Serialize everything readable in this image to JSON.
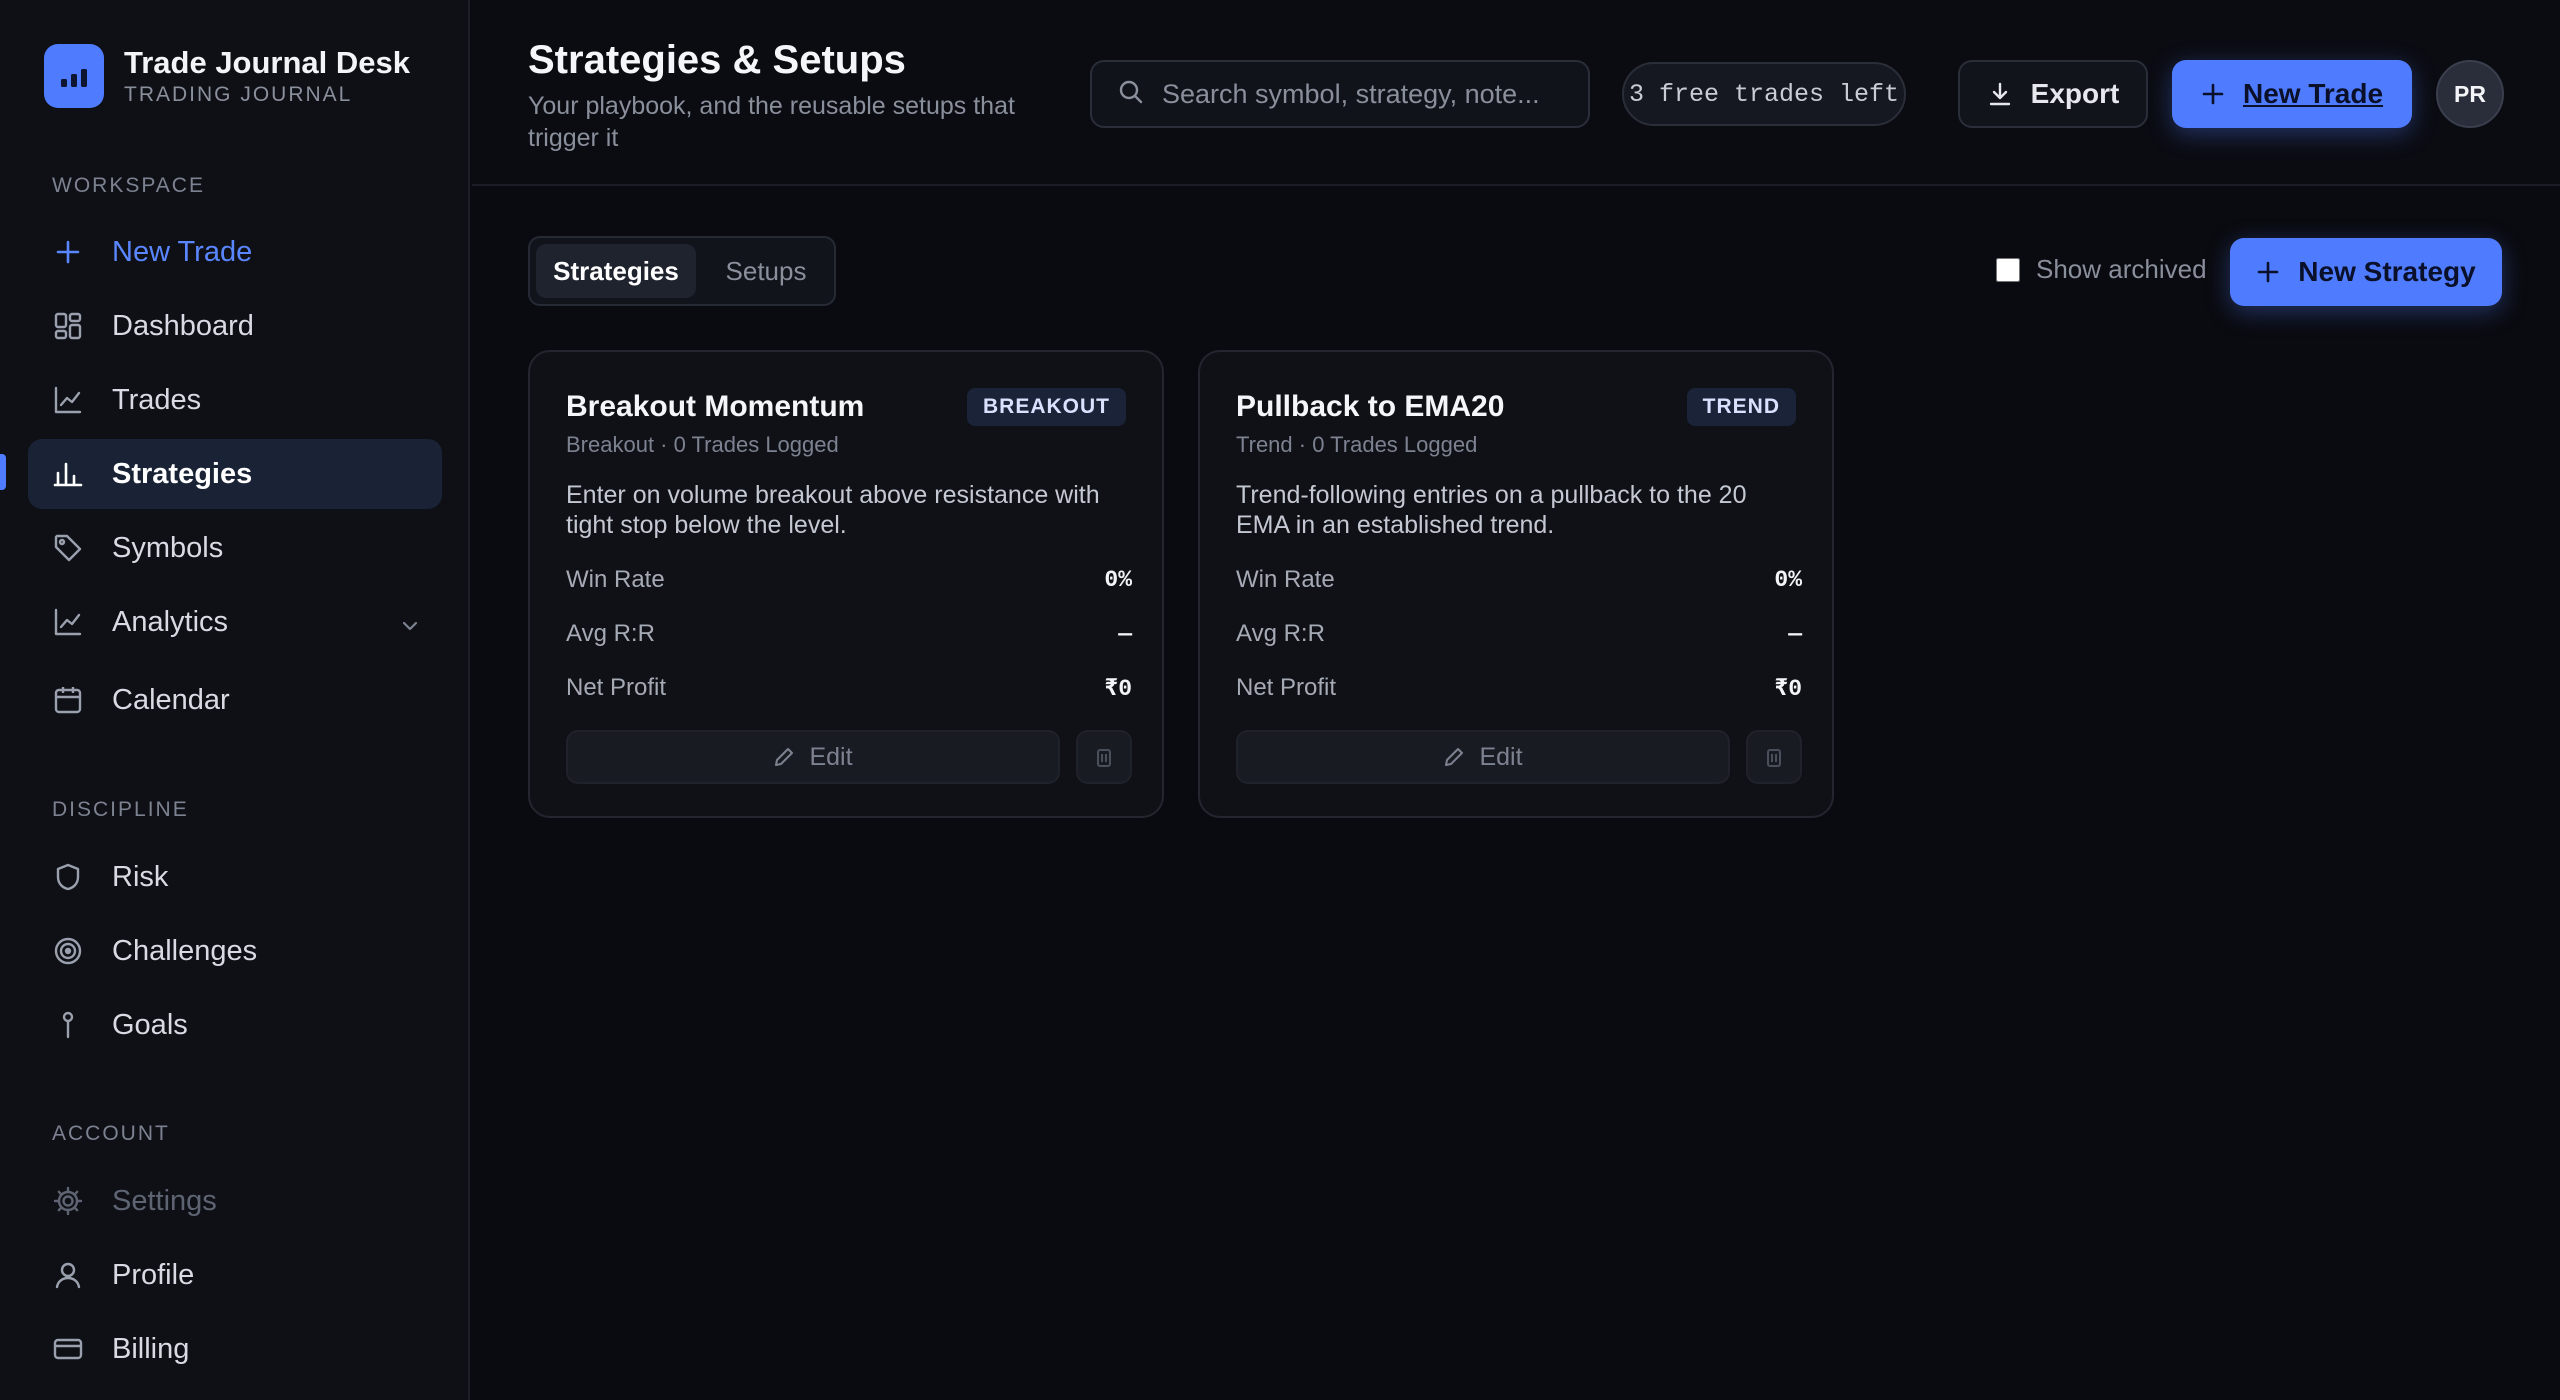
{
  "app": {
    "brand_title": "Trade Journal Desk",
    "brand_subtitle": "TRADING JOURNAL"
  },
  "sidebar": {
    "sections": [
      {
        "label": "WORKSPACE",
        "items": [
          {
            "label": "New Trade",
            "icon": "plus-icon"
          },
          {
            "label": "Dashboard",
            "icon": "grid-icon"
          },
          {
            "label": "Trades",
            "icon": "line-chart-icon"
          },
          {
            "label": "Strategies",
            "icon": "bar-chart-icon",
            "active": true
          },
          {
            "label": "Symbols",
            "icon": "tag-icon"
          },
          {
            "label": "Analytics",
            "icon": "analytics-icon"
          },
          {
            "label": "Calendar",
            "icon": "calendar-icon"
          }
        ]
      },
      {
        "label": "DISCIPLINE",
        "items": [
          {
            "label": "Risk",
            "icon": "shield-icon"
          },
          {
            "label": "Challenges",
            "icon": "target-icon"
          },
          {
            "label": "Goals",
            "icon": "pin-icon"
          }
        ]
      },
      {
        "label": "ACCOUNT",
        "items": [
          {
            "label": "Settings",
            "icon": "gear-icon"
          },
          {
            "label": "Profile",
            "icon": "user-icon"
          },
          {
            "label": "Billing",
            "icon": "credit-card-icon"
          }
        ]
      }
    ]
  },
  "header": {
    "title": "Strategies & Setups",
    "subtitle": "Your playbook, and the reusable setups that trigger it",
    "search_placeholder": "Search symbol, strategy, note...",
    "free_trades": "3 free trades left",
    "export_label": "Export",
    "new_trade_label": "New Trade",
    "avatar_initials": "PR"
  },
  "main": {
    "tabs": [
      {
        "label": "Strategies",
        "active": true
      },
      {
        "label": "Setups",
        "active": false
      }
    ],
    "show_archived_label": "Show archived",
    "show_archived_checked": false,
    "new_strategy_label": "New Strategy",
    "cards": [
      {
        "name": "Breakout Momentum",
        "badge": "BREAKOUT",
        "meta": "Breakout · 0 Trades Logged",
        "description": "Enter on volume breakout above resistance with tight stop below the level.",
        "stats": [
          {
            "label": "Win Rate",
            "value": "0%"
          },
          {
            "label": "Avg R:R",
            "value": "—"
          },
          {
            "label": "Net Profit",
            "value": "₹0"
          }
        ],
        "edit_label": "Edit"
      },
      {
        "name": "Pullback to EMA20",
        "badge": "TREND",
        "meta": "Trend · 0 Trades Logged",
        "description": "Trend-following entries on a pullback to the 20 EMA in an established trend.",
        "stats": [
          {
            "label": "Win Rate",
            "value": "0%"
          },
          {
            "label": "Avg R:R",
            "value": "—"
          },
          {
            "label": "Net Profit",
            "value": "₹0"
          }
        ],
        "edit_label": "Edit"
      }
    ]
  },
  "colors": {
    "accent": "#4f7cff",
    "background": "#0a0b10",
    "sidebar": "#0e1016",
    "active_nav": "#1a2336"
  }
}
